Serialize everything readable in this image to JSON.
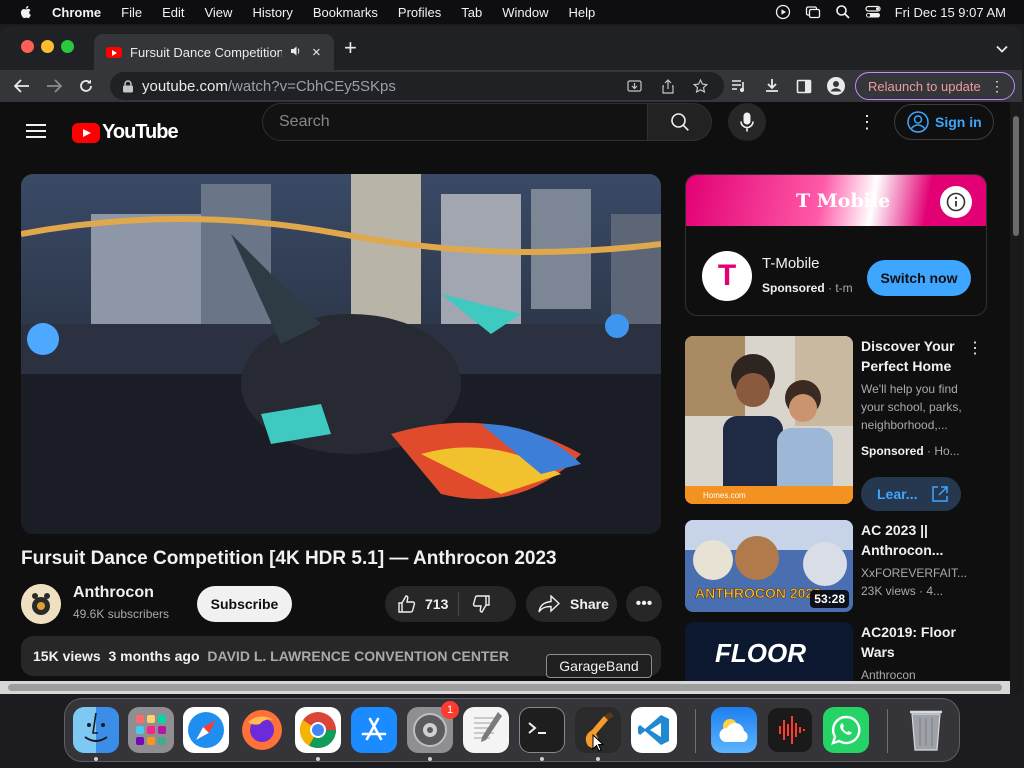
{
  "menubar": {
    "app": "Chrome",
    "items": [
      "File",
      "Edit",
      "View",
      "History",
      "Bookmarks",
      "Profiles",
      "Tab",
      "Window",
      "Help"
    ],
    "clock": "Fri Dec 15  9:07 AM"
  },
  "browser": {
    "tab_title": "Fursuit Dance Competition",
    "url_host": "youtube.com",
    "url_path": "/watch?v=CbhCEy5SKps",
    "relaunch_label": "Relaunch to update"
  },
  "youtube": {
    "logo_text": "YouTube",
    "search_placeholder": "Search",
    "sign_in_label": "Sign in",
    "video": {
      "title": "Fursuit Dance Competition [4K HDR 5.1] — Anthrocon 2023",
      "channel": "Anthrocon",
      "subscribers": "49.6K subscribers",
      "subscribe_label": "Subscribe",
      "likes": "713",
      "share_label": "Share",
      "views": "15K views",
      "age": "3 months ago",
      "location": "DAVID L. LAWRENCE CONVENTION CENTER"
    },
    "ad": {
      "banner_brand": "T Mobile",
      "name": "T-Mobile",
      "sponsored": "Sponsored",
      "sponsor_domain": "· t-m",
      "cta": "Switch now"
    },
    "recommendations": [
      {
        "title": "Discover Your Perfect Home",
        "description": "We'll help you find your school, parks, neighborhood,...",
        "sponsored": "Sponsored",
        "sponsor_domain": "· Ho...",
        "cta": "Lear...",
        "thumb_caption": "Homes.com"
      },
      {
        "title": "AC 2023 || Anthrocon...",
        "channel": "XxFOREVERFAIT...",
        "stats": "23K views · 4...",
        "duration": "53:28",
        "thumb_text": "ANTHROCON 2023"
      },
      {
        "title": "AC2019: Floor Wars",
        "channel": "Anthrocon",
        "thumb_text": "FLOOR"
      }
    ]
  },
  "dock": {
    "tooltip": "GarageBand",
    "settings_badge": "1",
    "apps": [
      "Finder",
      "Launchpad",
      "Safari",
      "Firefox",
      "Chrome",
      "App Store",
      "System Settings",
      "TextEdit",
      "Terminal",
      "GarageBand",
      "Visual Studio Code",
      "Weather",
      "Voice Memos",
      "WhatsApp",
      "Trash"
    ]
  },
  "colors": {
    "youtube_red": "#ff0000",
    "link_blue": "#3ea6ff",
    "tmobile_magenta": "#e20074",
    "page_bg": "#0f0f0f"
  }
}
